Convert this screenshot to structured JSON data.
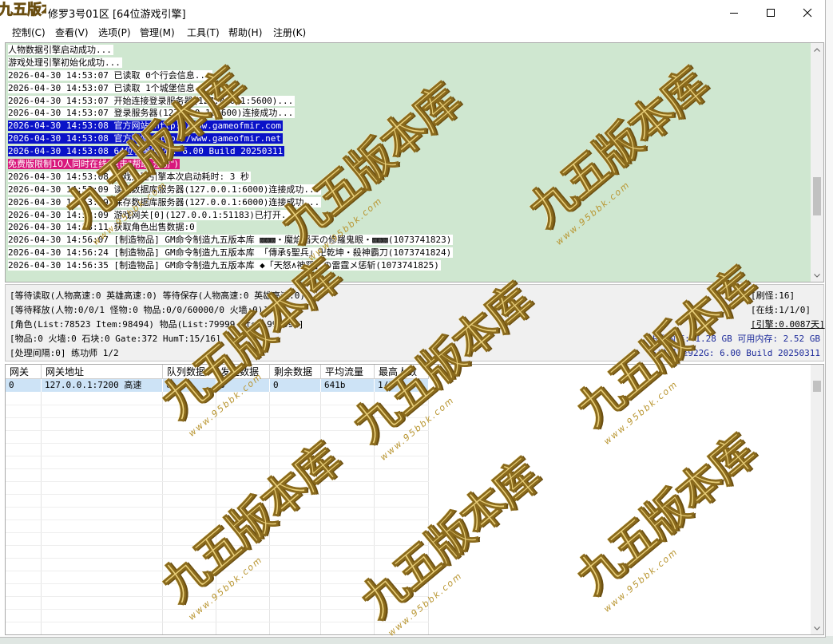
{
  "window": {
    "title_prefix": "九五版本库",
    "title": "修罗3号01区 [64位游戏引擎]",
    "minimize_icon": "minimize-icon",
    "maximize_icon": "maximize-icon",
    "close_icon": "close-icon"
  },
  "menu": {
    "items": [
      "控制(C)",
      "查看(V)",
      "选项(P)",
      "管理(M)",
      "工具(T)",
      "帮助(H)",
      "注册(K)"
    ]
  },
  "log": {
    "lines": [
      {
        "text": "人物数据引擎启动成功...",
        "style": "white"
      },
      {
        "text": "游戏处理引擎初始化成功...",
        "style": "white"
      },
      {
        "text": "2026-04-30 14:53:07 已读取 0个行会信息...",
        "style": "white"
      },
      {
        "text": "2026-04-30 14:53:07 已读取 1个城堡信息...",
        "style": "white"
      },
      {
        "text": "2026-04-30 14:53:07 开始连接登录服务器(127.0.0.1:5600)...",
        "style": "white"
      },
      {
        "text": "2026-04-30 14:53:07 登录服务器(127.0.0.1:5600)连接成功...",
        "style": "white"
      },
      {
        "text": "2026-04-30 14:53:08 官方网站 http://www.gameofmir.com",
        "style": "blue"
      },
      {
        "text": "2026-04-30 14:53:08 官方网站 http://www.gameofmir.net",
        "style": "blue"
      },
      {
        "text": "2026-04-30 14:53:08 64位引擎922G: 6.00 Build 20250311",
        "style": "blue"
      },
      {
        "text": "免费版限制10人同时在线(点击\"帮助-注册\")",
        "style": "pink"
      },
      {
        "text": "2026-04-30 14:53:08 游戏处理引擎本次启动耗时: 3 秒",
        "style": "white"
      },
      {
        "text": "2026-04-30 14:53:09 读取数据库服务器(127.0.0.1:6000)连接成功...",
        "style": "white"
      },
      {
        "text": "2026-04-30 14:53:09 保存数据库服务器(127.0.0.1:6000)连接成功...",
        "style": "white"
      },
      {
        "text": "2026-04-30 14:53:09 游戏网关[0](127.0.0.1:51183)已打开...",
        "style": "white"
      },
      {
        "text": "2026-04-30 14:53:11 获取角色出售数据:0",
        "style": "white"
      },
      {
        "text": "2026-04-30 14:56:07 [制造物品] GM命令制造九五版本库 ▩▩▩・魔焰滔天の修羅鬼眼・▩▩▩(1073741823)",
        "style": "white"
      },
      {
        "text": "2026-04-30 14:56:24 [制造物品] GM命令制造九五版本库 「傳承§聖兵」卍乾坤・殺神霸刀(1073741824)",
        "style": "white"
      },
      {
        "text": "2026-04-30 14:56:35 [制造物品] GM命令制造九五版本库 ◆「天怒∧神罚」の雷霆メ惩斩(1073741825)",
        "style": "white"
      }
    ]
  },
  "status": {
    "left": [
      "[等待读取(人物高速:0 英雄高速:0) 等待保存(人物高速:0 英雄高速:0)]",
      "[等待释放(人物:0/0/1 怪物:0 物品:0/0/60000/0 火墙:0)]",
      "[角色(List:78523 Item:98494) 物品(List:79999 Item:99999)]",
      "[物品:0 火墙:0 石块:0 Gate:372 HumT:15/16]",
      "[处理间隔:0]   练功师 1/2"
    ],
    "right": [
      "[刷怪:16]",
      "[在线:1/1/0]",
      "[引擎:0.0087天]",
      "占用内存: 1.28 GB 可用内存: 2.52 GB",
      "64位引擎922G: 6.00 Build 20250311"
    ]
  },
  "grid": {
    "headers": [
      "网关",
      "网关地址",
      "队列数据",
      "发送数据",
      "剩余数据",
      "平均流量",
      "最高人数"
    ],
    "rows": [
      [
        "0",
        "127.0.0.1:7200 高速",
        "0",
        "3",
        "0",
        "641b",
        "1/1"
      ]
    ]
  },
  "watermark": {
    "text": "九五版本库",
    "url": "www.95bbk.com"
  },
  "colors": {
    "log_bg": "#cfe7d0",
    "highlight_blue": "#0a12c8",
    "highlight_pink": "#d8187c",
    "selected_row": "#cde3f6",
    "status_blue": "#1c2a9a"
  }
}
